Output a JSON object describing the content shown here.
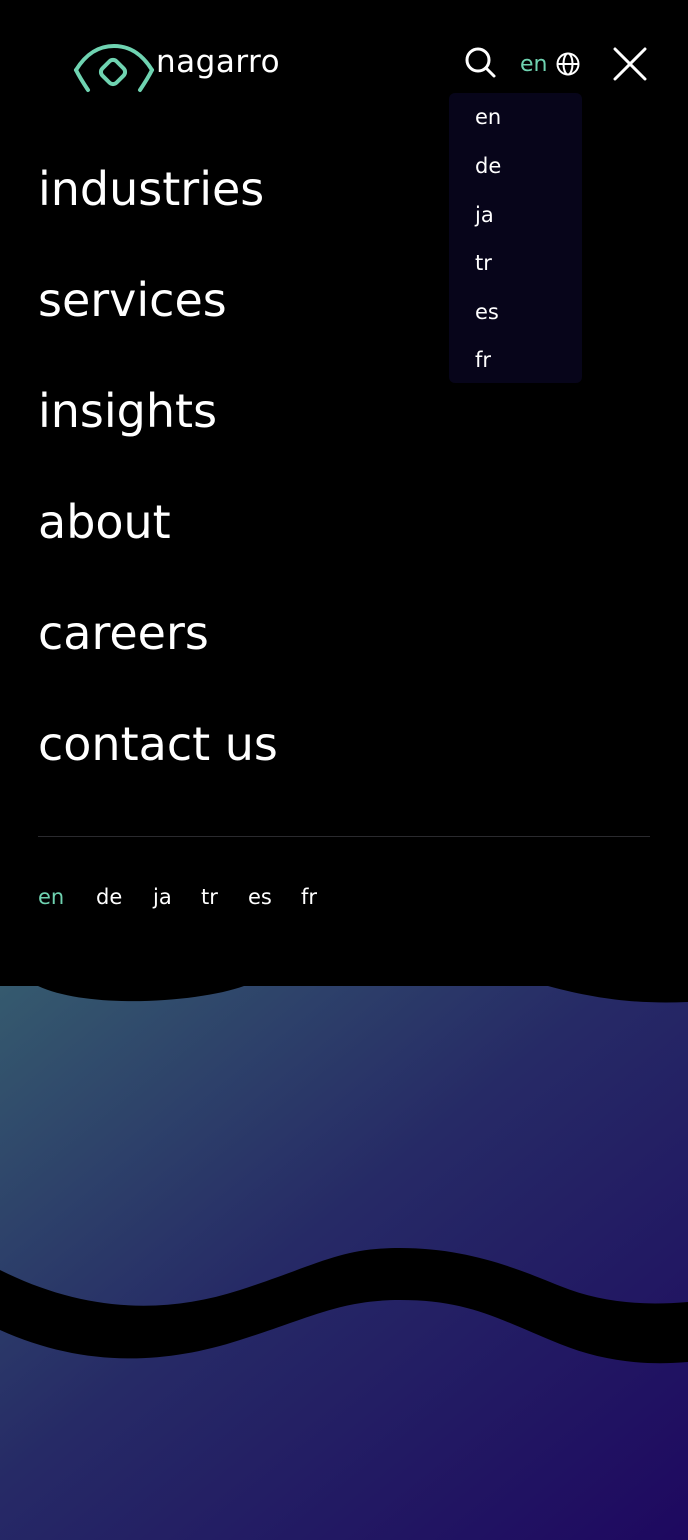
{
  "brand": {
    "name": "nagarro",
    "accent": "#6fd3b1"
  },
  "header": {
    "search_icon": "search-icon",
    "current_language": "en",
    "globe_icon": "globe-icon",
    "close_icon": "close-icon"
  },
  "language_dropdown": {
    "options": [
      "en",
      "de",
      "ja",
      "tr",
      "es",
      "fr"
    ]
  },
  "nav": {
    "items": [
      "industries",
      "services",
      "insights",
      "about",
      "careers",
      "contact us"
    ]
  },
  "language_row": {
    "active": "en",
    "items": [
      "en",
      "de",
      "ja",
      "tr",
      "es",
      "fr"
    ]
  },
  "colors": {
    "background": "#000000",
    "dropdown_bg": "#07051a",
    "gradient_start": "#355a6e",
    "gradient_mid": "#262a66",
    "gradient_end": "#1e0860"
  }
}
